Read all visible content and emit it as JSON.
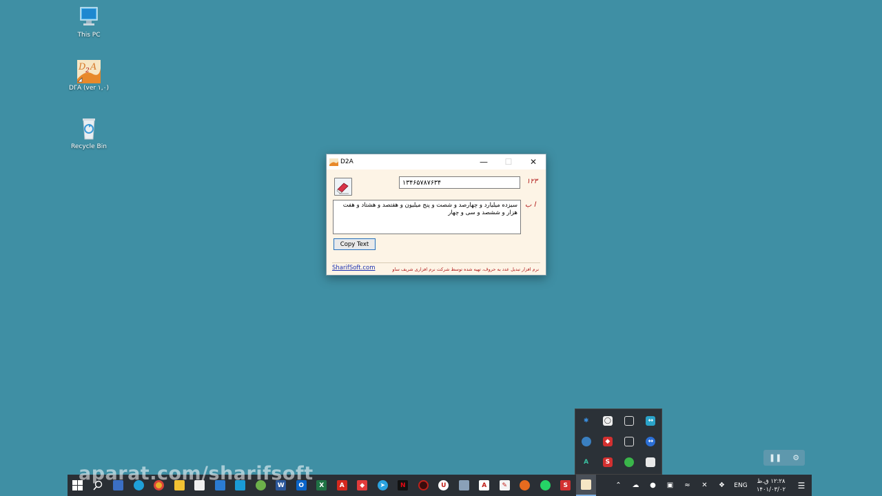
{
  "desktop": {
    "icons": [
      {
        "label": "This PC",
        "icon": "this-pc-icon"
      },
      {
        "label": "DΓA (ver ۱,۰)",
        "icon": "d2a-shortcut-icon"
      },
      {
        "label": "Recycle Bin",
        "icon": "recycle-bin-icon"
      }
    ]
  },
  "window": {
    "title": "D2A",
    "number_value": "۱۳۴۶۵۷۸۷۶۳۴",
    "number_label": "۱۲۳",
    "words_label": "ا ب",
    "words_output": "سیزده میلیارد و چهارصد و شصت و پنج میلیون و هفتصد و هشتاد و هفت هزار و ششصد و سی و چهار",
    "copy_button": "Copy Text",
    "site_link": "SharifSoft.com",
    "footer_text": "نرم افزار تبدیل عدد به حروف، تهیه شده توسط شرکت نرم افزاری شریف ساو"
  },
  "watermark": "aparat.com/sharifsoft",
  "taskbar": {
    "language": "ENG",
    "clock_time": "۱۲:۲۸ ق.ظ",
    "clock_date": "۱۴۰۱/۰۳/۰۲"
  },
  "colors": {
    "desktop_bg": "#3f8fa4",
    "window_bg": "#fdf4e6",
    "accent_red": "#b01818",
    "link_blue": "#1a2fb0",
    "taskbar_bg": "#2a2f35"
  }
}
